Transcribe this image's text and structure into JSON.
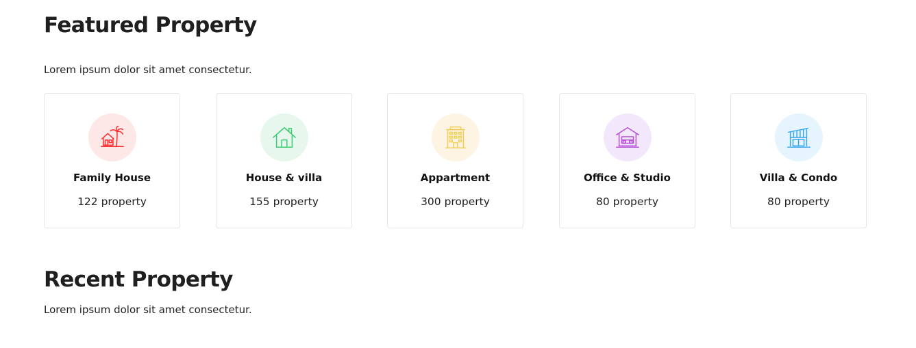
{
  "featured": {
    "title": "Featured Property",
    "subtitle": "Lorem ipsum dolor sit amet consectetur."
  },
  "categories": [
    {
      "name": "Family House",
      "count": "122 property",
      "icon": "beach-house-icon",
      "icon_color": "#ff2d2d",
      "bg_color": "#fde7e7"
    },
    {
      "name": "House & villa",
      "count": "155 property",
      "icon": "house-icon",
      "icon_color": "#3bcc73",
      "bg_color": "#e7f7ed"
    },
    {
      "name": "Appartment",
      "count": "300 property",
      "icon": "apartment-building-icon",
      "icon_color": "#f0cf5a",
      "bg_color": "#fef4e3"
    },
    {
      "name": "Office & Studio",
      "count": "80 property",
      "icon": "office-studio-icon",
      "icon_color": "#b44fd6",
      "bg_color": "#f3e8fb"
    },
    {
      "name": "Villa & Condo",
      "count": "80 property",
      "icon": "villa-condo-icon",
      "icon_color": "#38a8f0",
      "bg_color": "#e6f4fd"
    }
  ],
  "recent": {
    "title": "Recent Property",
    "subtitle": "Lorem ipsum dolor sit amet consectetur."
  }
}
